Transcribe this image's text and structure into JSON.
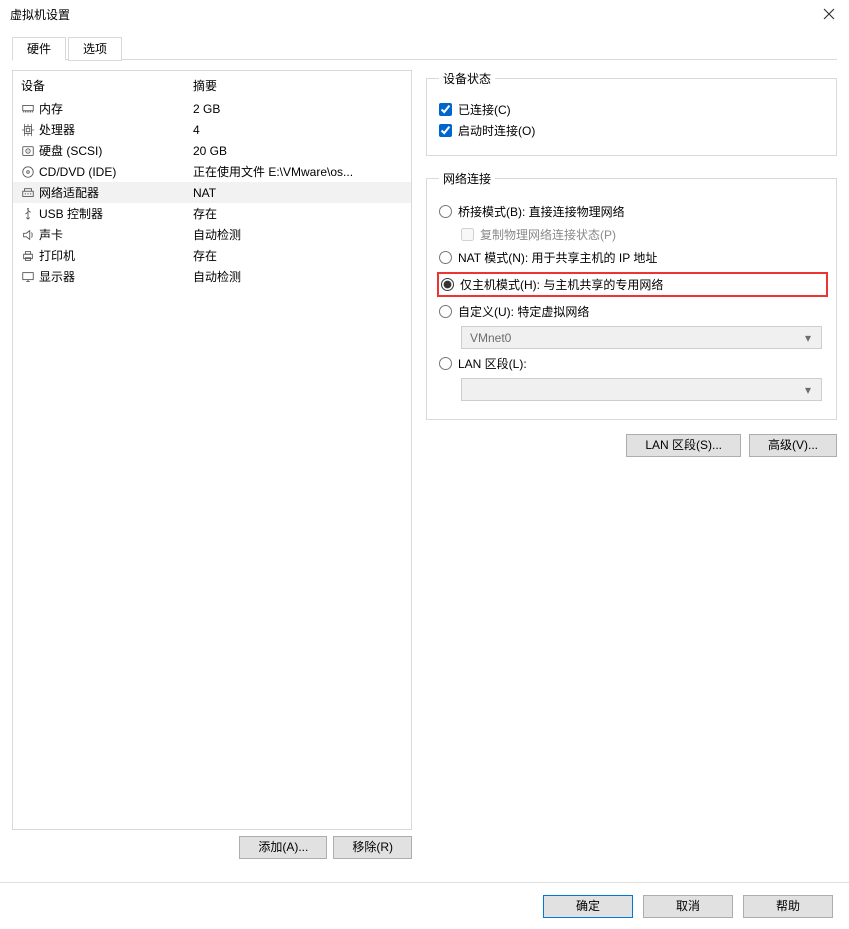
{
  "title": "虚拟机设置",
  "tabs": {
    "hardware": "硬件",
    "options": "选项"
  },
  "device_header": {
    "device": "设备",
    "summary": "摘要"
  },
  "devices": [
    {
      "icon": "memory",
      "name": "内存",
      "summary": "2 GB"
    },
    {
      "icon": "cpu",
      "name": "处理器",
      "summary": "4"
    },
    {
      "icon": "disk",
      "name": "硬盘 (SCSI)",
      "summary": "20 GB"
    },
    {
      "icon": "cd",
      "name": "CD/DVD (IDE)",
      "summary": "正在使用文件 E:\\VMware\\os..."
    },
    {
      "icon": "net",
      "name": "网络适配器",
      "summary": "NAT"
    },
    {
      "icon": "usb",
      "name": "USB 控制器",
      "summary": "存在"
    },
    {
      "icon": "sound",
      "name": "声卡",
      "summary": "自动检测"
    },
    {
      "icon": "printer",
      "name": "打印机",
      "summary": "存在"
    },
    {
      "icon": "display",
      "name": "显示器",
      "summary": "自动检测"
    }
  ],
  "selected_device_index": 4,
  "left_buttons": {
    "add": "添加(A)...",
    "remove": "移除(R)"
  },
  "status": {
    "legend": "设备状态",
    "connected": "已连接(C)",
    "connect_on_power": "启动时连接(O)"
  },
  "netconn": {
    "legend": "网络连接",
    "bridge": "桥接模式(B): 直接连接物理网络",
    "bridge_copy": "复制物理网络连接状态(P)",
    "nat": "NAT 模式(N): 用于共享主机的 IP 地址",
    "hostonly": "仅主机模式(H): 与主机共享的专用网络",
    "custom": "自定义(U): 特定虚拟网络",
    "custom_combo": "VMnet0",
    "lanseg": "LAN 区段(L):",
    "selected": "hostonly"
  },
  "right_buttons": {
    "lan": "LAN 区段(S)...",
    "advanced": "高级(V)..."
  },
  "bottom": {
    "ok": "确定",
    "cancel": "取消",
    "help": "帮助"
  }
}
